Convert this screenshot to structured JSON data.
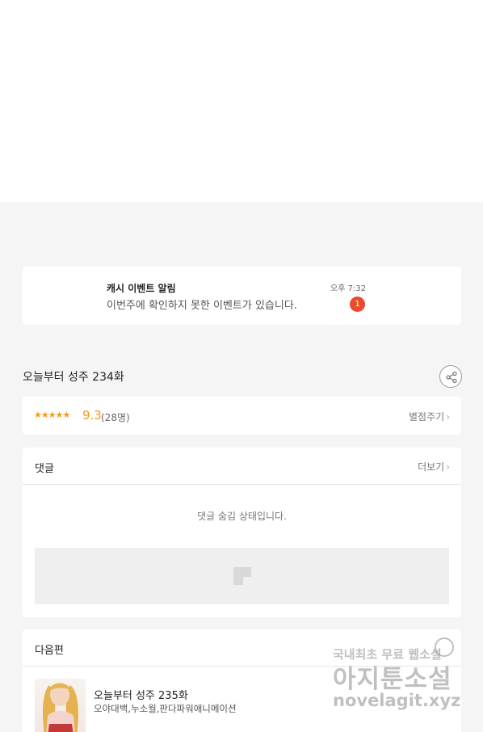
{
  "notification": {
    "title": "캐시 이벤트 알림",
    "message": "이번주에 확인하지 못한 이벤트가 있습니다.",
    "time": "오후 7:32",
    "badge_count": "1"
  },
  "episode": {
    "title": "오늘부터 성주 234화",
    "share_icon": "share-icon"
  },
  "rating": {
    "stars": "★★★★★",
    "star_fraction": 0.93,
    "score": "9.3",
    "count": "(28명)",
    "rate_button": "별점주기",
    "chevron": "›"
  },
  "comments": {
    "title": "댓글",
    "more_button": "더보기",
    "hidden_message": "댓글 숨김 상태입니다."
  },
  "next_episode": {
    "header": "다음편",
    "title": "오늘부터 성주 235화",
    "author": "오야대백,누소월,판다파워애니메이션"
  },
  "watermark": {
    "line1": "국내최초 무료 웹소설",
    "line2": "아지툰소설",
    "line3": "novelagit.xyz"
  },
  "colors": {
    "accent": "#f59a1b",
    "badge": "#ea4b2e",
    "background": "#f5f5f5"
  }
}
